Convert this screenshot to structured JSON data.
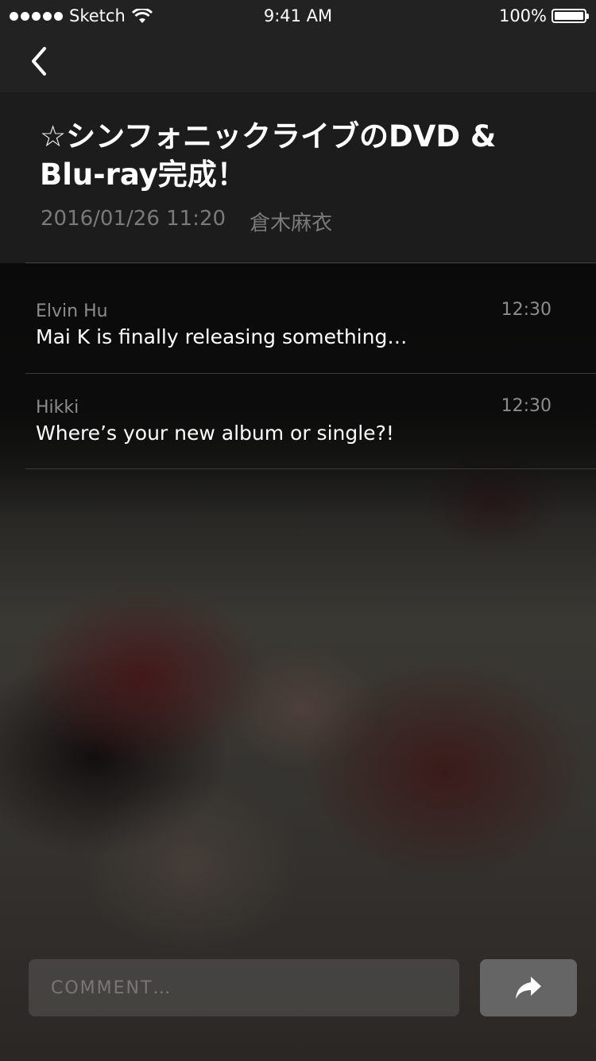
{
  "status_bar": {
    "carrier": "Sketch",
    "time": "9:41 AM",
    "battery": "100%"
  },
  "nav": {
    "back_icon": "chevron-left-icon"
  },
  "post": {
    "title": "☆シンフォニックライブのDVD & Blu-ray完成！",
    "date": "2016/01/26 11:20",
    "author": "倉木麻衣"
  },
  "comments": [
    {
      "author": "Elvin Hu",
      "time": "12:30",
      "text": "Mai K is finally releasing something…"
    },
    {
      "author": "Hikki",
      "time": "12:30",
      "text": "Where’s your new album or single?!"
    }
  ],
  "composer": {
    "placeholder": "COMMENT…",
    "value": "",
    "send_icon": "share-arrow-icon"
  }
}
